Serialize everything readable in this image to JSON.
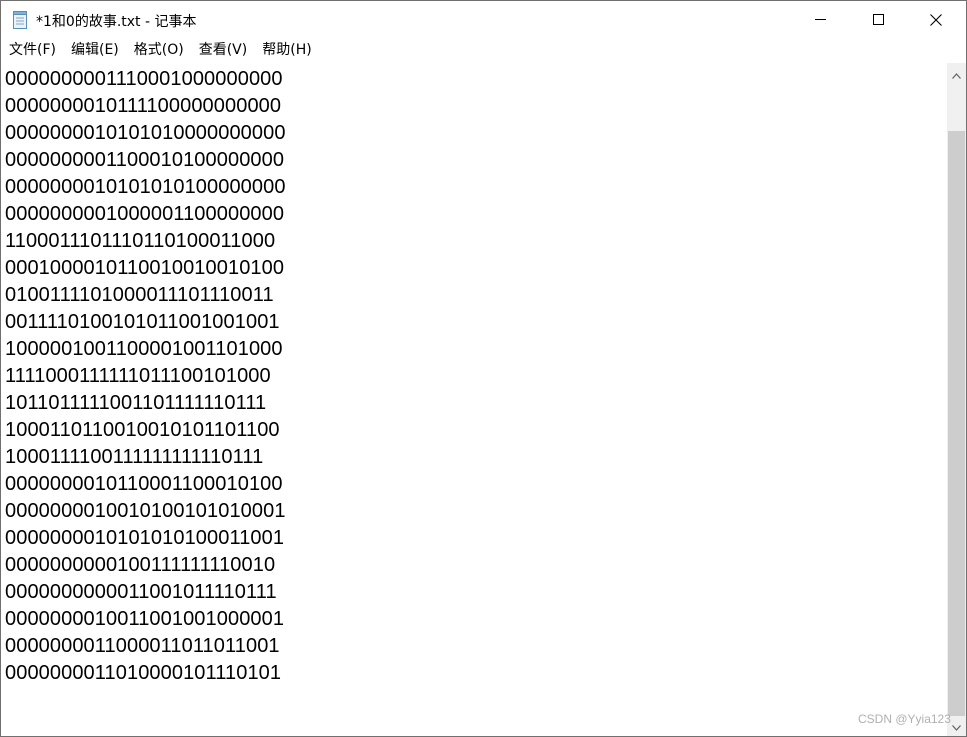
{
  "window": {
    "title": "*1和0的故事.txt - 记事本",
    "app_icon": "notepad-icon",
    "controls": {
      "minimize_icon": "minimize-icon",
      "maximize_icon": "maximize-icon",
      "close_icon": "close-icon"
    }
  },
  "menu": {
    "items": [
      {
        "label": "文件(F)"
      },
      {
        "label": "编辑(E)"
      },
      {
        "label": "格式(O)"
      },
      {
        "label": "查看(V)"
      },
      {
        "label": "帮助(H)"
      }
    ]
  },
  "editor": {
    "lines": [
      "0000000001110001000000000",
      "0000000010111100000000000",
      "0000000010101010000000000",
      "0000000001100010100000000",
      "0000000010101010100000000",
      "0000000001000001100000000",
      "1100011101110110100011000",
      "0001000010110010010010100",
      "0100111101000011101110011",
      "0011110100101011001001001",
      "1000001001100001001101000",
      "1111000111111011100101000",
      "1011011111001101111110111",
      "1000110110010010101101100",
      "1000111100111111111110111",
      "0000000010110001100010100",
      "0000000010010100101010001",
      "0000000010101010100011001",
      "0000000000100111111110010",
      "0000000000011001011110111",
      "0000000010011001001000001",
      "0000000011000011011011001",
      "0000000011010000101110101"
    ]
  },
  "scrollbar": {
    "up_icon": "scroll-up-arrow-icon",
    "down_icon": "scroll-down-arrow-icon"
  },
  "watermark": "CSDN @Yyia123"
}
